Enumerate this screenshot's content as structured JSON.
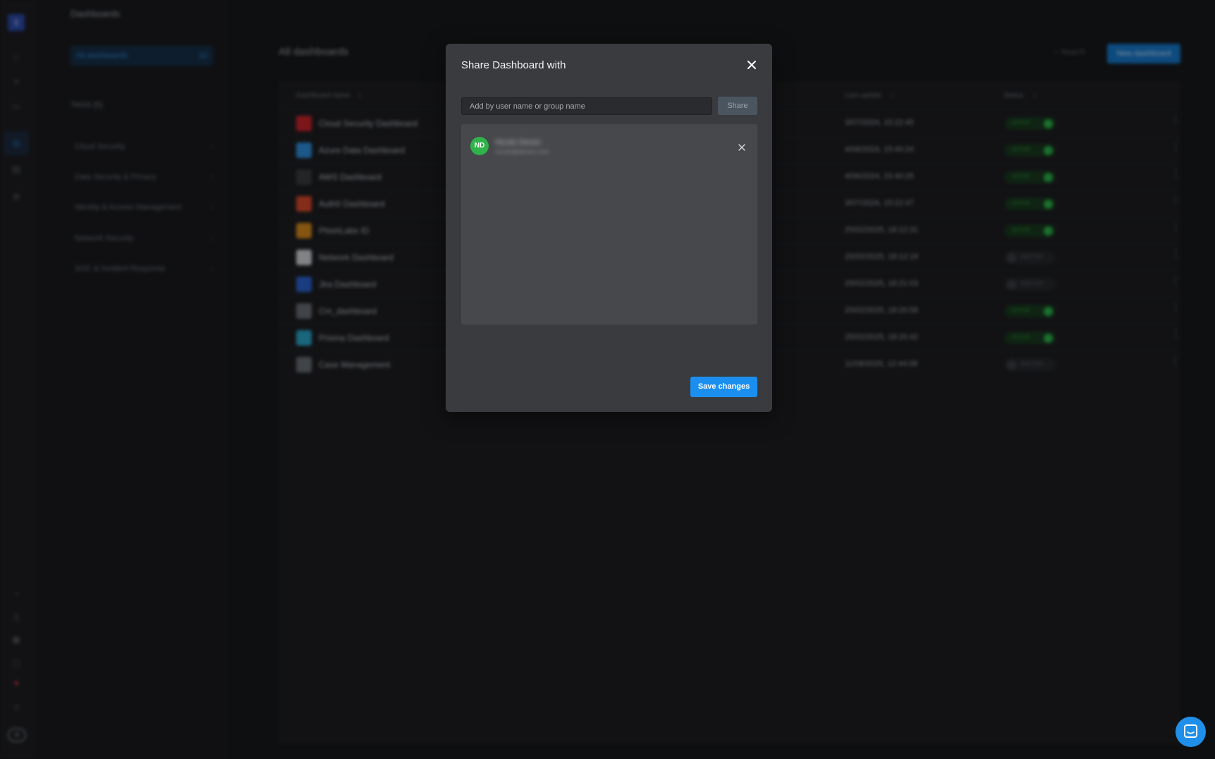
{
  "app": {
    "logo_letter": "S",
    "rail_icons": [
      "home-icon",
      "list-icon",
      "window-icon",
      "dashboard-icon",
      "clipboard-icon",
      "settings-icon",
      "analytics-icon",
      "users-icon",
      "package-icon",
      "report-icon",
      "alert-icon",
      "help-icon",
      "profile-icon"
    ],
    "section_title": "Dashboards",
    "all_dashboards": {
      "label": "All dashboards",
      "count": "10"
    },
    "tags_title": "TAGS (5)",
    "tags": [
      "Cloud Security",
      "Data Security & Privacy",
      "Identity & Access Management",
      "Network Security",
      "SOC & Incident Response"
    ],
    "main_title": "All dashboards",
    "search_label": "Search",
    "new_dashboard_label": "New dashboard",
    "table": {
      "headers": {
        "name": "Dashboard name",
        "last_update": "Last update",
        "status": "Status"
      },
      "rows": [
        {
          "name": "Cloud Security Dashboard",
          "last_update": "3/07/2024, 15:22:45",
          "status": "ACTIVE",
          "icon_color": "#c9242b"
        },
        {
          "name": "Azure Data Dashboard",
          "last_update": "4/06/2024, 15:40:24",
          "status": "ACTIVE",
          "icon_color": "#2f8fe0"
        },
        {
          "name": "AWS Dashboard",
          "last_update": "4/06/2024, 15:40:25",
          "status": "ACTIVE",
          "icon_color": "#3a3c40"
        },
        {
          "name": "Auth0 Dashboard",
          "last_update": "3/07/2024, 15:22:47",
          "status": "ACTIVE",
          "icon_color": "#d9482b"
        },
        {
          "name": "PhishLabs ID",
          "last_update": "25/02/2025, 18:12:31",
          "status": "ACTIVE",
          "icon_color": "#d8891c"
        },
        {
          "name": "Network Dashboard",
          "last_update": "25/02/2025, 18:12:19",
          "status": "INACTIVE",
          "icon_color": "#d0d3d7"
        },
        {
          "name": "Jira Dashboard",
          "last_update": "25/02/2025, 18:21:03",
          "status": "INACTIVE",
          "icon_color": "#2b63d1"
        },
        {
          "name": "Cm_dashboard",
          "last_update": "25/02/2025, 18:20:58",
          "status": "ACTIVE",
          "icon_color": "#6a6e74"
        },
        {
          "name": "Prisma Dashboard",
          "last_update": "25/02/2025, 18:20:42",
          "status": "ACTIVE",
          "icon_color": "#2aa6c9"
        },
        {
          "name": "Case Management",
          "last_update": "11/08/2025, 12:44:08",
          "status": "INACTIVE",
          "icon_color": "#6a6e74"
        }
      ]
    }
  },
  "modal": {
    "title": "Share Dashboard with",
    "input_placeholder": "Add by user name or group name",
    "input_value": "",
    "share_label": "Share",
    "users": [
      {
        "initials": "ND",
        "name": "Nicole Deven",
        "email": "nicole@deven.com",
        "avatar_color": "#2fb249"
      }
    ],
    "save_label": "Save changes"
  },
  "colors": {
    "accent": "#1b8ff0",
    "modal_bg": "#3a3b3f",
    "active_status": "#2bb34a"
  }
}
